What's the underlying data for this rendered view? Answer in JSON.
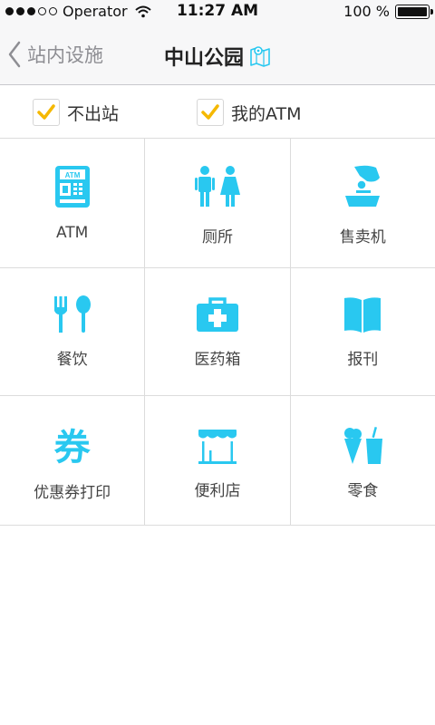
{
  "status_bar": {
    "carrier": "Operator",
    "time": "11:27 AM",
    "battery": "100 %",
    "battery_level": 1.0
  },
  "nav": {
    "back_label": "站内设施",
    "title": "中山公园"
  },
  "filters": [
    {
      "label": "不出站",
      "checked": true
    },
    {
      "label": "我的ATM",
      "checked": true
    }
  ],
  "colors": {
    "accent": "#29c8f0",
    "check": "#f5b800"
  },
  "facilities": [
    {
      "label": "ATM",
      "icon": "atm-icon"
    },
    {
      "label": "厕所",
      "icon": "restroom-icon"
    },
    {
      "label": "售卖机",
      "icon": "vending-machine-icon"
    },
    {
      "label": "餐饮",
      "icon": "dining-icon"
    },
    {
      "label": "医药箱",
      "icon": "medical-kit-icon"
    },
    {
      "label": "报刊",
      "icon": "newspaper-icon"
    },
    {
      "label": "优惠券打印",
      "icon": "coupon-icon",
      "glyph": "券"
    },
    {
      "label": "便利店",
      "icon": "convenience-store-icon"
    },
    {
      "label": "零食",
      "icon": "snacks-icon"
    }
  ]
}
